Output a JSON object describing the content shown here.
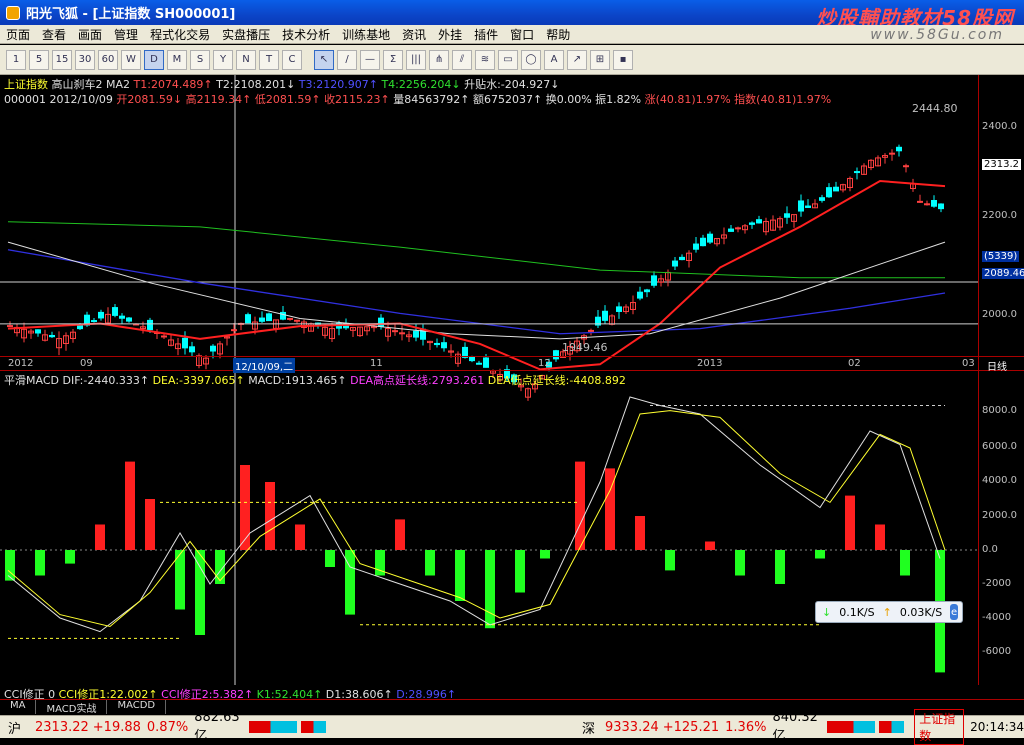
{
  "window": {
    "title": "阳光飞狐 - [上证指数  SH000001]",
    "watermark": "炒股輔助教材58股网",
    "watermark_url": "www.58Gu.com"
  },
  "menu": [
    "页面",
    "查看",
    "画面",
    "管理",
    "程式化交易",
    "实盘播压",
    "技术分析",
    "训练基地",
    "资讯",
    "外挂",
    "插件",
    "窗口",
    "帮助"
  ],
  "header1": {
    "name": "上证指数",
    "ind": "高山刹车2",
    "ma": "MA2",
    "t1": "T1:2074.489↑",
    "t2": "T2:2108.201↓",
    "t3": "T3:2120.907↑",
    "t4": "T4:2256.204↓",
    "water": "升贴水:-204.927↓"
  },
  "header2": {
    "code": "000001",
    "date": "2012/10/09",
    "open": "开2081.59↓",
    "high": "高2119.34↑",
    "low": "低2081.59↑",
    "close": "收2115.23↑",
    "vol": "量84563792↑",
    "amt": "额6752037↑",
    "turn": "换0.00%",
    "amp": "振1.82%",
    "chg": "涨(40.81)1.97%",
    "idx": "指数(40.81)1.97%"
  },
  "macd_header": {
    "name": "平滑MACD",
    "dif": "DIF:-2440.333↑",
    "dea": "DEA:-3397.065↑",
    "macd": "MACD:1913.465↑",
    "deah": "DEA高点延长线:2793.261",
    "deal": "DEA低点延长线:-4408.892"
  },
  "cci_header": {
    "name": "CCI修正",
    "zero": "0",
    "c1": "CCI修正1:22.002↑",
    "c2": "CCI修正2:5.382↑",
    "k1": "K1:52.404↑",
    "d1": "D1:38.606↑",
    "x": "D:28.996↑"
  },
  "dates": {
    "y2012": "2012",
    "m09": "09",
    "cursor": "12/10/09,二",
    "m11": "11",
    "m12": "12",
    "y2013": "2013",
    "m02": "02",
    "m03": "03",
    "daily": "日线"
  },
  "price_axis": [
    "2400.0",
    "2200.0",
    "2000.0"
  ],
  "price_labels": {
    "current": "2313.2",
    "cursor": "2089.46",
    "count": "(5339)",
    "high": "2444.80",
    "low": "1949.46"
  },
  "macd_axis": [
    "8000.0",
    "6000.0",
    "4000.0",
    "2000.0",
    "0.0",
    "-2000",
    "-4000",
    "-6000"
  ],
  "tabs": [
    "MA",
    "MACD实战",
    "MACDD"
  ],
  "status": {
    "sh_label": "沪",
    "sh_price": "2313.22",
    "sh_chg": "+19.88",
    "sh_pct": "0.87%",
    "sh_amt": "882.63亿",
    "sz_label": "深",
    "sz_price": "9333.24",
    "sz_chg": "+125.21",
    "sz_pct": "1.36%",
    "sz_amt": "840.32亿",
    "index": "上证指数",
    "time": "20:14:34"
  },
  "speed": {
    "down": "0.1K/S",
    "up": "0.03K/S"
  },
  "chart_data": {
    "type": "candlestick",
    "title": "上证指数 SH000001",
    "ylim": [
      1930,
      2480
    ],
    "period_labels": [
      "2012-09",
      "2012-10",
      "2012-11",
      "2012-12",
      "2013-01",
      "2013-02",
      "2013-03"
    ],
    "high": 2444.8,
    "low": 1949.46,
    "last": 2313.22
  }
}
